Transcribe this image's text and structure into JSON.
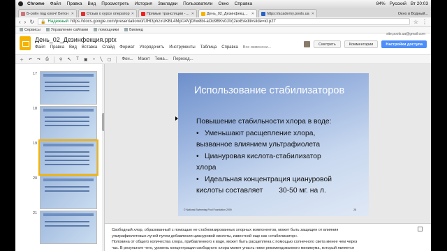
{
  "macbar": {
    "app": "Chrome",
    "menu": [
      "Файл",
      "Правка",
      "Вид",
      "Просмотреть",
      "История",
      "Закладки",
      "Пользователи",
      "Окно",
      "Справка"
    ],
    "right": {
      "battery": "84%",
      "input": "Русский",
      "time": "Вт 20:03"
    }
  },
  "tabs": [
    {
      "title": "Б-сейн под ключ! Бетон",
      "color": "#c77"
    },
    {
      "title": "Отзыв о курсе оператор",
      "color": "#d33"
    },
    {
      "title": "Прямые трансляции - Ут",
      "color": "#e22"
    },
    {
      "title": "День_02_Дезинфекция.р",
      "color": "#f4b400",
      "active": true
    },
    {
      "title": "https://academy.pools.ua",
      "color": "#2b63c6"
    }
  ],
  "tab_user": "Окно в Водный...",
  "address": {
    "secure": "Надежный",
    "url": "https://docs.google.com/presentation/d/1fHl3phzxUKBL4MpfJ4VjDhw8bt-aOo9BKv0JlV|2exE/edit#slide=id.p27"
  },
  "bookmarks": [
    "Сервисы",
    "Управление сайтами",
    "помощники",
    "Биомед"
  ],
  "doc": {
    "title": "День_02_Дезинфекция.pptx",
    "menu": [
      "Файл",
      "Правка",
      "Вид",
      "Вставка",
      "Слайд",
      "Формат",
      "Упорядочить",
      "Инструменты",
      "Таблица",
      "Справка"
    ],
    "changes": "Все изменени...",
    "email": "site.pools.ua@gmail.com",
    "present": "Смотреть",
    "comments": "Комментарии",
    "share": "Настройки доступа"
  },
  "toolbar": [
    "Фон...",
    "Макет",
    "Тема...",
    "Переход..."
  ],
  "thumbs": [
    {
      "num": "17"
    },
    {
      "num": "18"
    },
    {
      "num": "19",
      "selected": true
    },
    {
      "num": "20"
    },
    {
      "num": "21"
    }
  ],
  "slide": {
    "title": "Использование стабилизаторов",
    "body": [
      {
        "text": "Повышение стабильности хлора в воде:",
        "bullet": false
      },
      {
        "text": "Уменьшают расщепление хлора,",
        "bullet": true
      },
      {
        "text": "вызванное влиянием ультрафиолета",
        "bullet": false
      },
      {
        "text": "Циануровая кислота-стабилизатор",
        "bullet": true
      },
      {
        "text": "хлора",
        "bullet": false
      },
      {
        "text": "Идеальная концентрация циануровой",
        "bullet": true
      },
      {
        "text": "кислоты составляет        30-50 мг. на л.",
        "bullet": false
      }
    ],
    "footer": "© National Swimming Pool Foundation 2009",
    "number": "28"
  },
  "notes": [
    "Свободный хлор, образованный с помощью не стабилизированных хлорных компонентов, может быть защищен от влияния",
    "ультрафиолетовых лучей путем добавления циануровой кислоты, известной еще как «стабилизатор».",
    "Половина от общего количества хлора, прибавленного к воде, может быть расщеплена с помощью солнечного света менее чем через",
    "час. В результате чего, уровень концентрации свободного хлора может упасть ниже рекомендованного минимума, который является"
  ]
}
